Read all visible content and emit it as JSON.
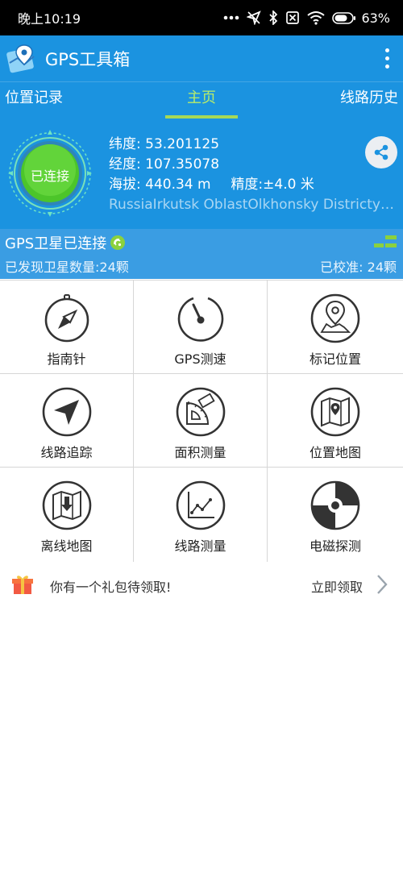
{
  "status_bar": {
    "time": "晚上10:19",
    "battery": "63%"
  },
  "app_bar": {
    "title": "GPS工具箱"
  },
  "tabs": [
    {
      "label": "位置记录",
      "active": false
    },
    {
      "label": "主页",
      "active": true
    },
    {
      "label": "线路历史",
      "active": false
    }
  ],
  "gps": {
    "status": "已连接",
    "latitude": "纬度: 53.201125",
    "longitude": "经度: 107.35078",
    "altitude": "海拔: 440.34 m",
    "accuracy": "精度:±4.0 米",
    "address": "RussiaIrkutsk OblastOlkhonsky Districtулица"
  },
  "satellite": {
    "title": "GPS卫星已连接",
    "found": "已发现卫星数量:24颗",
    "calibrated": "已校准: 24颗"
  },
  "tools": [
    {
      "label": "指南针",
      "icon": "compass-icon"
    },
    {
      "label": "GPS测速",
      "icon": "speedometer-icon"
    },
    {
      "label": "标记位置",
      "icon": "map-pin-icon"
    },
    {
      "label": "线路追踪",
      "icon": "navigation-arrow-icon"
    },
    {
      "label": "面积测量",
      "icon": "protractor-icon"
    },
    {
      "label": "位置地图",
      "icon": "location-map-icon"
    },
    {
      "label": "离线地图",
      "icon": "offline-map-icon"
    },
    {
      "label": "线路测量",
      "icon": "line-chart-icon"
    },
    {
      "label": "电磁探测",
      "icon": "radiation-icon"
    }
  ],
  "gift": {
    "text": "你有一个礼包待领取!",
    "action": "立即领取"
  },
  "colors": {
    "primary": "#1b93e0",
    "tab_active": "#a6d957",
    "connected_green": "#4cc52a",
    "satellite_bar": "#3a9de3"
  }
}
